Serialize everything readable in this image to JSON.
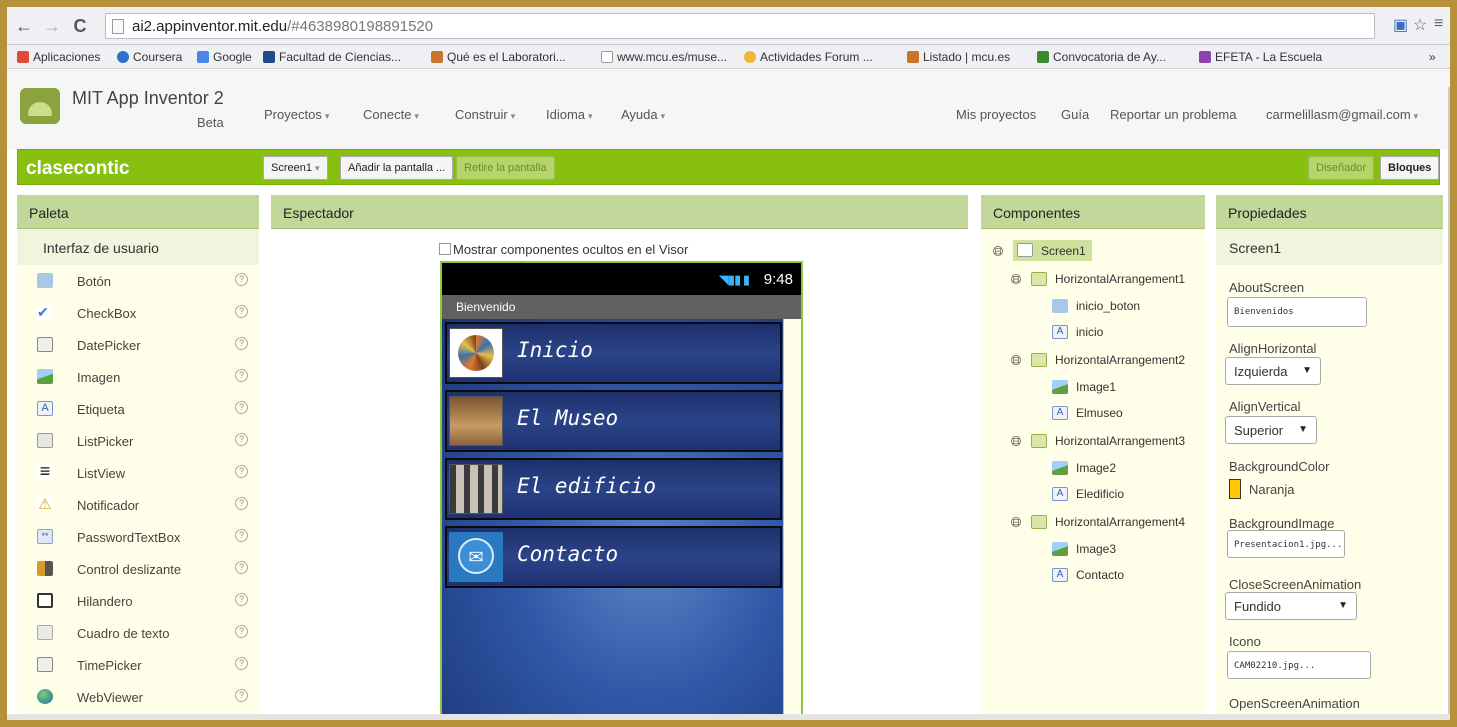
{
  "browser": {
    "url_host": "ai2.appinventor.mit.edu",
    "url_path": "/#4638980198891520",
    "bookmarks": [
      "Aplicaciones",
      "Coursera",
      "Google",
      "Facultad de Ciencias...",
      "Qué es el Laboratori...",
      "www.mcu.es/muse...",
      "Actividades Forum ...",
      "Listado | mcu.es",
      "Convocatoria de Ay...",
      "EFETA - La Escuela"
    ],
    "more": "»"
  },
  "header": {
    "brand": "MIT App Inventor 2",
    "brand_sub": "Beta",
    "menu": [
      "Proyectos",
      "Conecte",
      "Construir",
      "Idioma",
      "Ayuda"
    ],
    "right": [
      "Mis proyectos",
      "Guía",
      "Reportar un problema"
    ],
    "account": "carmelillasm@gmail.com"
  },
  "project": {
    "name": "clasecontic",
    "screen_select": "Screen1",
    "add_screen": "Añadir la pantalla ...",
    "remove_screen": "Retire la pantalla",
    "designer": "Diseñador",
    "blocks": "Bloques"
  },
  "panels": {
    "palette": "Paleta",
    "viewer": "Espectador",
    "components": "Componentes",
    "properties": "Propiedades"
  },
  "palette": {
    "category": "Interfaz de usuario",
    "help_glyph": "?",
    "items": [
      "Botón",
      "CheckBox",
      "DatePicker",
      "Imagen",
      "Etiqueta",
      "ListPicker",
      "ListView",
      "Notificador",
      "PasswordTextBox",
      "Control deslizante",
      "Hilandero",
      "Cuadro de texto",
      "TimePicker",
      "WebViewer"
    ]
  },
  "viewer": {
    "show_hidden": "Mostrar componentes ocultos en el Visor",
    "time": "9:48",
    "screen_title": "Bienvenido",
    "rows": [
      "Inicio",
      "El Museo",
      "El edificio",
      "Contacto"
    ]
  },
  "components": {
    "root": "Screen1",
    "groups": [
      {
        "name": "HorizontalArrangement1",
        "children": [
          "inicio_boton",
          "inicio"
        ]
      },
      {
        "name": "HorizontalArrangement2",
        "children": [
          "Image1",
          "Elmuseo"
        ]
      },
      {
        "name": "HorizontalArrangement3",
        "children": [
          "Image2",
          "Eledificio"
        ]
      },
      {
        "name": "HorizontalArrangement4",
        "children": [
          "Image3",
          "Contacto"
        ]
      }
    ],
    "collapse_glyph": "⊟"
  },
  "properties": {
    "component": "Screen1",
    "about_label": "AboutScreen",
    "about_value": "Bienvenidos",
    "align_h_label": "AlignHorizontal",
    "align_h_value": "Izquierda",
    "align_v_label": "AlignVertical",
    "align_v_value": "Superior",
    "bg_color_label": "BackgroundColor",
    "bg_color_value": "Naranja",
    "bg_color_hex": "#ffc800",
    "bg_image_label": "BackgroundImage",
    "bg_image_value": "Presentacion1.jpg...",
    "close_anim_label": "CloseScreenAnimation",
    "close_anim_value": "Fundido",
    "icon_label": "Icono",
    "icon_value": "CAM02210.jpg...",
    "open_anim_label": "OpenScreenAnimation"
  },
  "colors": {
    "accent": "#88c010",
    "panel_header": "#c2d89a"
  }
}
